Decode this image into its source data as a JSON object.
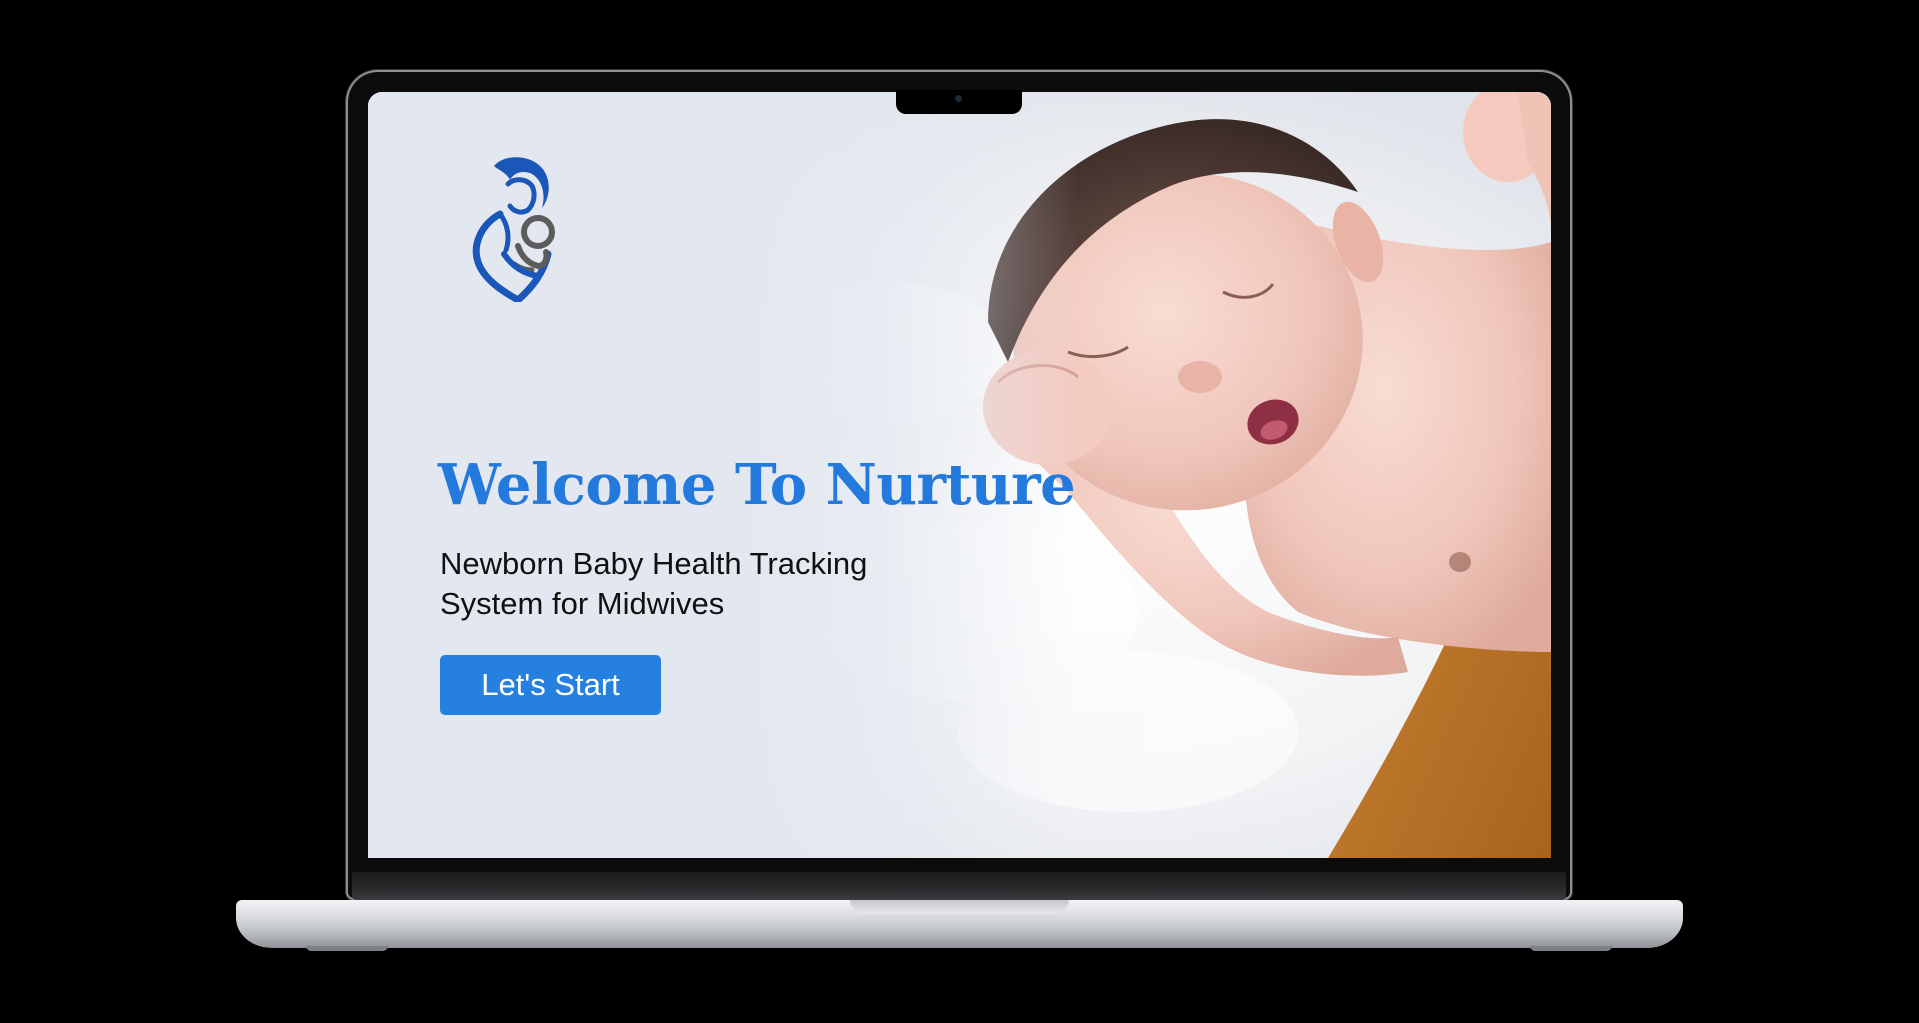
{
  "app": {
    "name": "Nurture",
    "accent_color": "#2379dc",
    "button_color": "#2580e0",
    "background_color": "#e3e8f0"
  },
  "landing": {
    "logo_icon": "mother-and-baby-logo-icon",
    "title": "Welcome To Nurture",
    "subtitle": "Newborn Baby Health Tracking System for Midwives",
    "cta_label": "Let's Start"
  },
  "hero_image": {
    "subject": "newborn-baby-sleeping-photo"
  },
  "device": {
    "frame": "laptop-mockup"
  }
}
